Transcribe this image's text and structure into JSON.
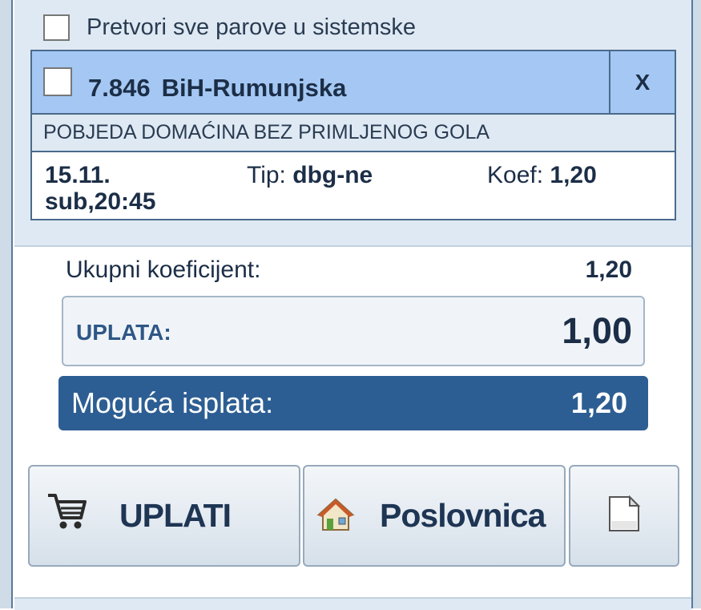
{
  "system_option": {
    "label": "Pretvori sve parove u sistemske",
    "checked": false
  },
  "match": {
    "code": "7.846",
    "name": "BiH-Rumunjska",
    "close_label": "X",
    "market": "POBJEDA DOMAĆINA BEZ PRIMLJENOG GOLA",
    "date_line1": "15.11.",
    "date_line2": "sub,20:45",
    "tip_label": "Tip:",
    "tip_value": "dbg-ne",
    "koef_label": "Koef:",
    "koef_value": "1,20"
  },
  "summary": {
    "total_label": "Ukupni koeficijent:",
    "total_value": "1,20",
    "stake_label": "UPLATA:",
    "stake_value": "1,00",
    "payout_label": "Moguća isplata:",
    "payout_value": "1,20"
  },
  "buttons": {
    "uplati_label": "UPLATI",
    "uplati_icon": "cart-icon",
    "poslovnica_label": "Poslovnica",
    "poslovnica_icon": "house-icon",
    "doc_icon": "document-icon"
  },
  "colors": {
    "header_bg": "#a4c8f3",
    "payout_bg": "#2d5e93",
    "text_dark": "#1c2e47"
  }
}
